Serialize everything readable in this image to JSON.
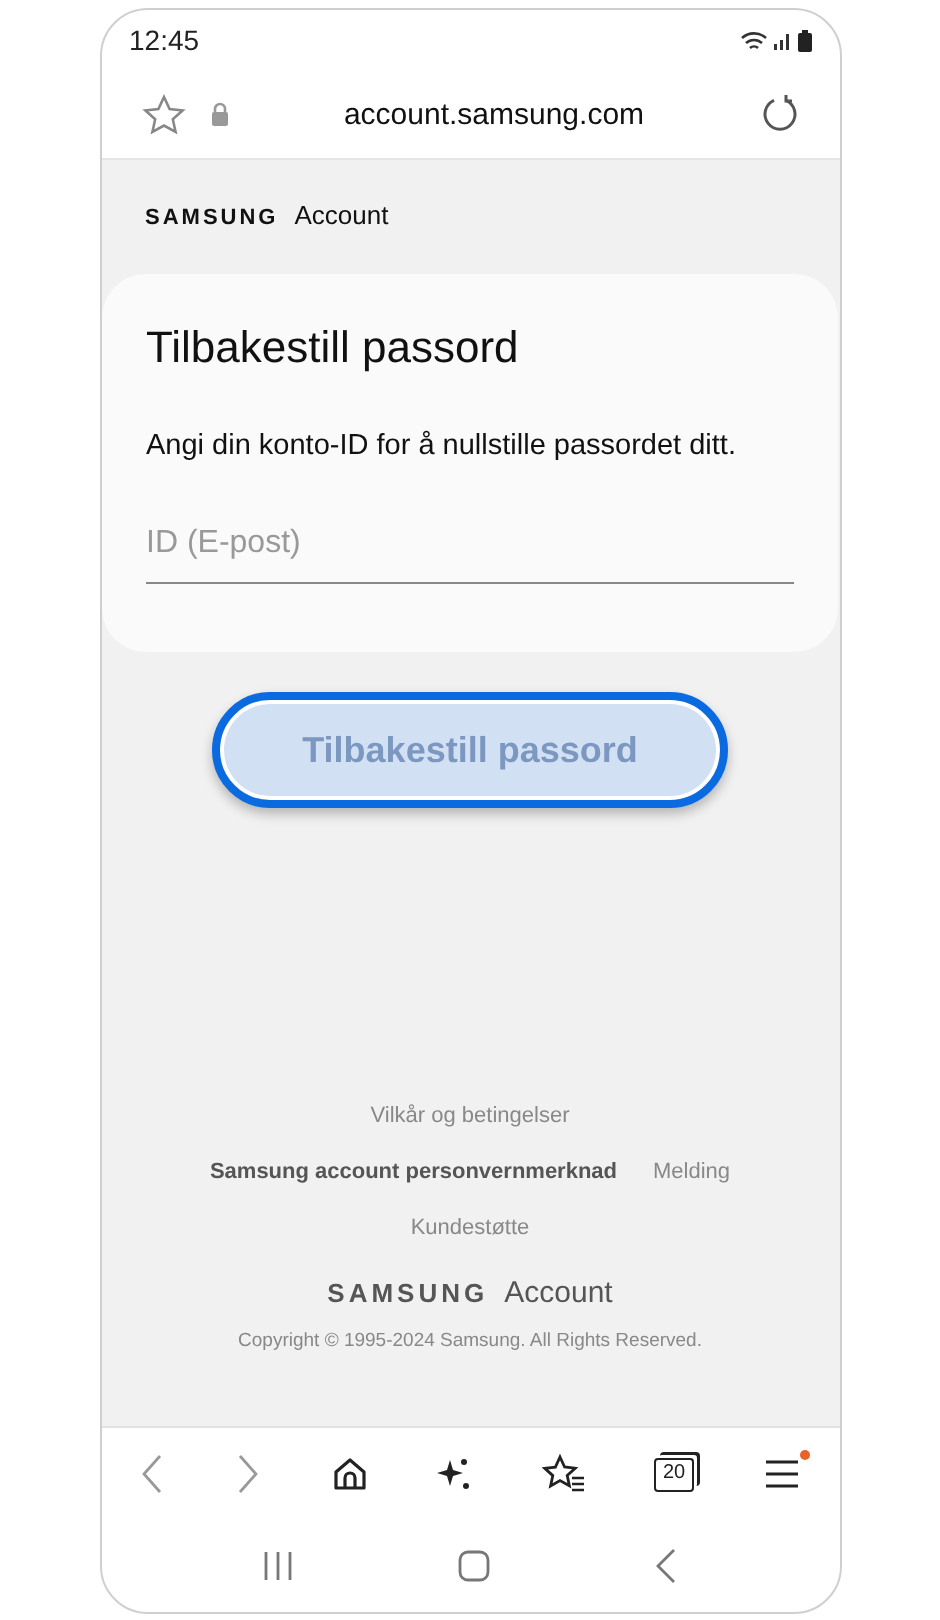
{
  "status_bar": {
    "time": "12:45"
  },
  "browser": {
    "url": "account.samsung.com"
  },
  "header": {
    "brand": "SAMSUNG",
    "product": "Account"
  },
  "card": {
    "title": "Tilbakestill passord",
    "instruction": "Angi din konto-ID for å nullstille passordet ditt.",
    "field": {
      "placeholder": "ID (E-post)"
    }
  },
  "submit_button": {
    "label": "Tilbakestill passord",
    "disabled": true,
    "focused": true
  },
  "footer": {
    "link_rows": [
      [
        {
          "label": "Vilkår og betingelser",
          "bold": false
        }
      ],
      [
        {
          "label": "Samsung account personvernmerknad",
          "bold": true
        },
        {
          "label": "Melding",
          "bold": false
        }
      ],
      [
        {
          "label": "Kundestøtte",
          "bold": false
        }
      ]
    ],
    "brand": "SAMSUNG",
    "product": "Account",
    "copyright": "Copyright © 1995-2024 Samsung. All Rights Reserved."
  },
  "toolbar": {
    "tab_count": "20",
    "menu_badge": true
  }
}
